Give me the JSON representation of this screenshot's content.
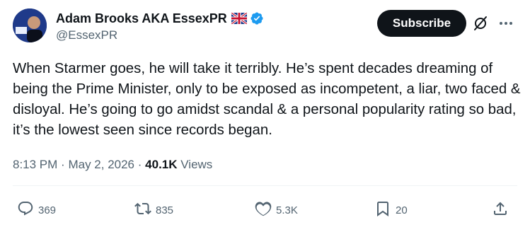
{
  "author": {
    "display_name": "Adam Brooks AKA EssexPR",
    "handle": "@EssexPR",
    "flag_icon": "uk-flag-icon",
    "verified_icon": "verified-badge-icon",
    "verified_color": "#1d9bf0"
  },
  "header": {
    "subscribe_label": "Subscribe",
    "grok_icon": "grok-icon",
    "more_icon": "more-dots-icon"
  },
  "tweet": {
    "text": "When Starmer goes, he will take it terribly. He’s spent decades dreaming of being the Prime Minister, only to be exposed as incompetent, a liar, two faced & disloyal. He’s going to go amidst scandal & a personal popularity rating so bad, it’s the lowest seen since records began.",
    "time": "8:13 PM",
    "date": "May 2, 2026",
    "separator": "·",
    "views_count": "40.1K",
    "views_label": "Views"
  },
  "actions": {
    "reply": {
      "icon": "reply-icon",
      "count": "369"
    },
    "retweet": {
      "icon": "retweet-icon",
      "count": "835"
    },
    "like": {
      "icon": "heart-icon",
      "count": "5.3K"
    },
    "bookmark": {
      "icon": "bookmark-icon",
      "count": "20"
    },
    "share": {
      "icon": "share-icon"
    }
  },
  "colors": {
    "text": "#0f1419",
    "secondary": "#536471",
    "button_bg": "#0f1419"
  }
}
